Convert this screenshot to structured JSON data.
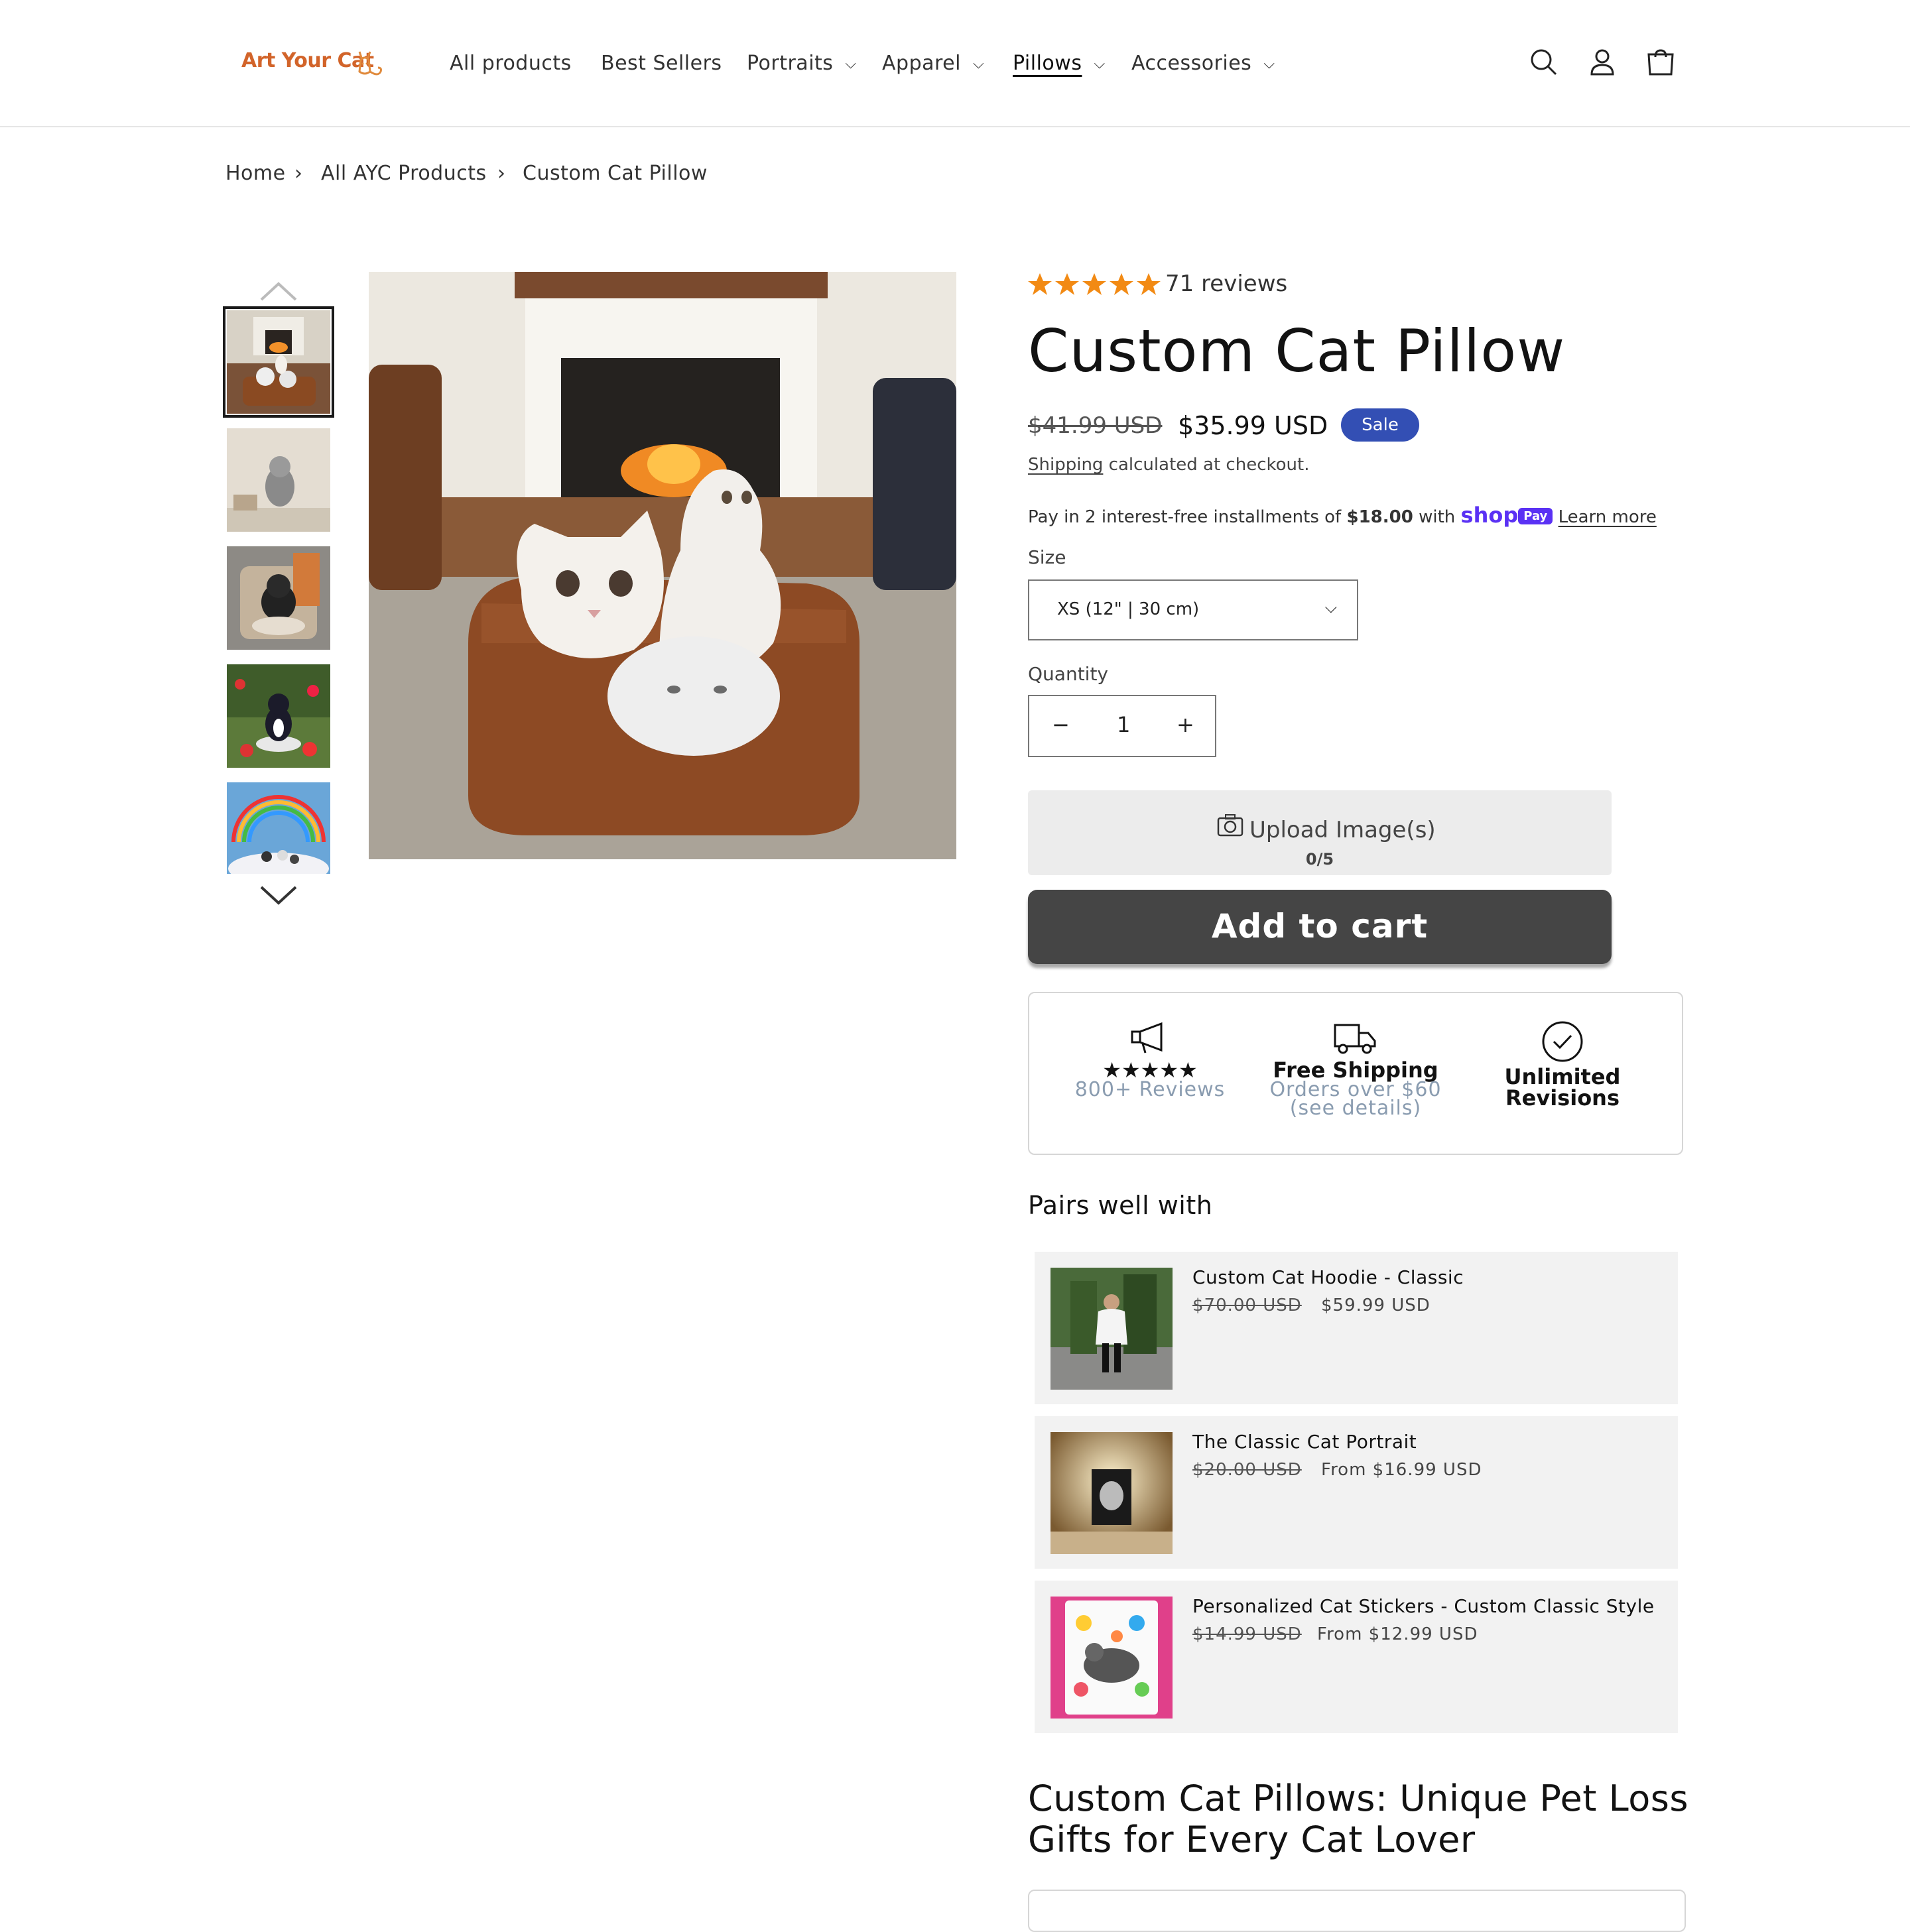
{
  "brand": {
    "logo_text": "Art Your Cat",
    "accent_color": "#d2642a"
  },
  "nav": {
    "items": [
      {
        "label": "All products",
        "has_dropdown": false
      },
      {
        "label": "Best Sellers",
        "has_dropdown": false
      },
      {
        "label": "Portraits",
        "has_dropdown": true
      },
      {
        "label": "Apparel",
        "has_dropdown": true
      },
      {
        "label": "Pillows",
        "has_dropdown": true,
        "active": true
      },
      {
        "label": "Accessories",
        "has_dropdown": true
      }
    ],
    "icons": [
      "search-icon",
      "account-icon",
      "cart-icon"
    ]
  },
  "breadcrumb": [
    "Home",
    "All AYC Products",
    "Custom Cat Pillow"
  ],
  "product": {
    "rating": 5,
    "reviews_label": "71 reviews",
    "title": "Custom Cat Pillow",
    "price_old": "$41.99 USD",
    "price_new": "$35.99 USD",
    "sale_badge": "Sale",
    "shipping_link": "Shipping",
    "shipping_rest": " calculated at checkout.",
    "installments_prefix": "Pay in 2 interest-free installments of ",
    "installments_amount": "$18.00",
    "installments_with": " with ",
    "shop_word": "shop",
    "shop_pay": "Pay",
    "learn_more": "Learn more",
    "size_label": "Size",
    "size_value": "XS (12\" | 30 cm)",
    "quantity_label": "Quantity",
    "quantity_value": "1",
    "quantity_minus": "−",
    "quantity_plus": "+",
    "upload_label": "Upload Image(s)",
    "upload_count": "0/5",
    "add_to_cart": "Add to cart",
    "brand_color": "#334fb4"
  },
  "badges": [
    {
      "icon": "megaphone-icon",
      "title": "★★★★★",
      "sub1": "800+ Reviews",
      "sub2": ""
    },
    {
      "icon": "truck-icon",
      "title": "Free Shipping",
      "sub1": "Orders over $60",
      "sub2": "(see details)"
    },
    {
      "icon": "check-circle-icon",
      "title": "Unlimited",
      "sub1": "Revisions",
      "sub2": ""
    }
  ],
  "pairs": {
    "heading": "Pairs well with",
    "items": [
      {
        "name": "Custom Cat Hoodie - Classic",
        "old": "$70.00 USD",
        "new": "$59.99 USD"
      },
      {
        "name": "The Classic Cat Portrait",
        "old": "$20.00 USD",
        "new": "From $16.99 USD"
      },
      {
        "name": "Personalized Cat Stickers - Custom Classic Style",
        "old": "$14.99 USD",
        "new": "From $12.99 USD"
      }
    ]
  },
  "article_heading": "Custom Cat Pillows: Unique Pet Loss Gifts for Every Cat Lover"
}
